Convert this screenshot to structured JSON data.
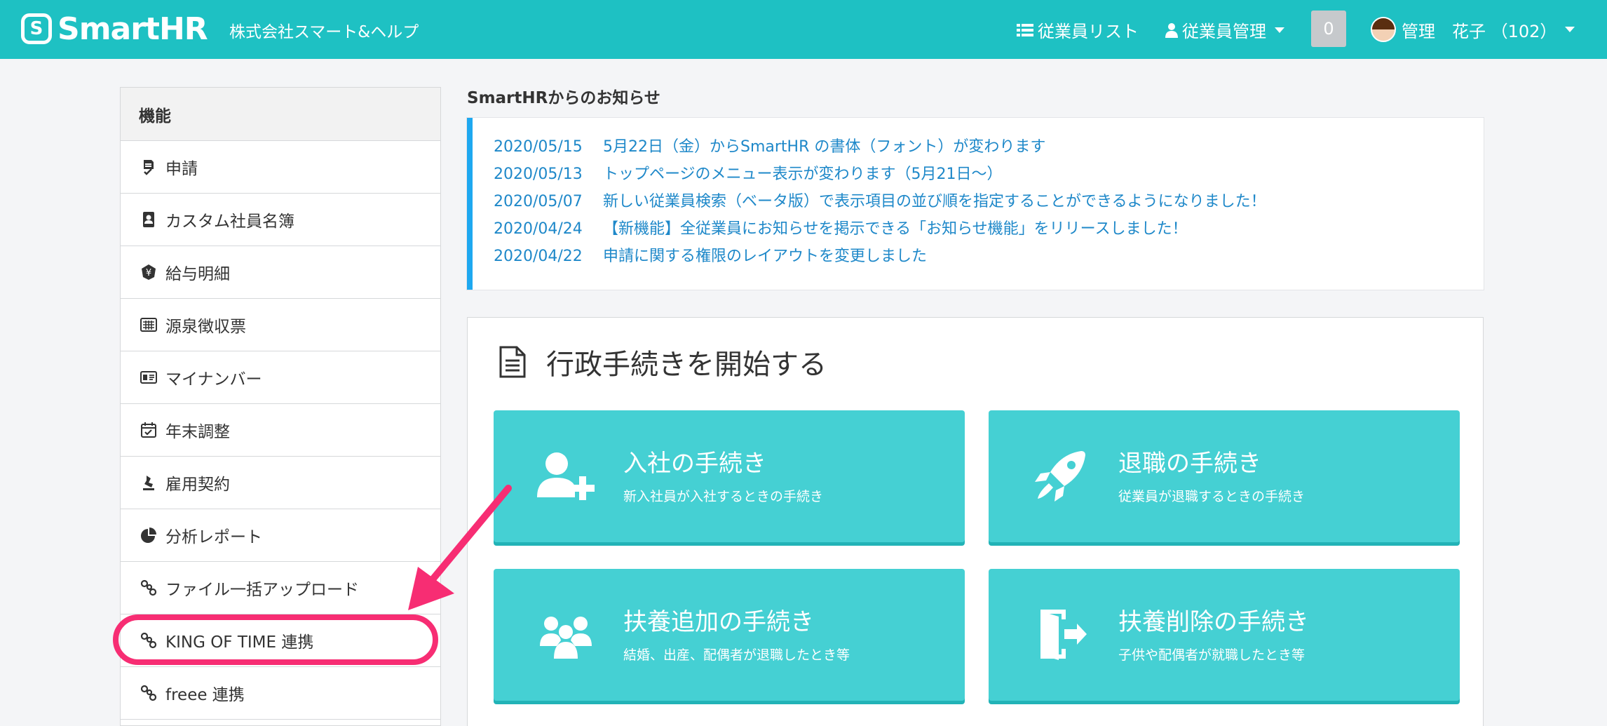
{
  "header": {
    "logo_mark": "S",
    "logo_text": "SmartHR",
    "company": "株式会社スマート&ヘルプ",
    "nav_employee_list": "従業員リスト",
    "nav_employee_manage": "従業員管理",
    "notification_count": "0",
    "user_name": "管理　花子 （102）",
    "brand_color": "#1ec1c3"
  },
  "sidebar": {
    "heading": "機能",
    "items": [
      {
        "label": "申請",
        "icon": "application-icon"
      },
      {
        "label": "カスタム社員名簿",
        "icon": "contact-book-icon"
      },
      {
        "label": "給与明細",
        "icon": "yen-badge-icon"
      },
      {
        "label": "源泉徴収票",
        "icon": "calculator-icon"
      },
      {
        "label": "マイナンバー",
        "icon": "id-card-icon"
      },
      {
        "label": "年末調整",
        "icon": "calendar-check-icon"
      },
      {
        "label": "雇用契約",
        "icon": "stamp-icon"
      },
      {
        "label": "分析レポート",
        "icon": "pie-chart-icon"
      },
      {
        "label": "ファイル一括アップロード",
        "icon": "link-icon"
      },
      {
        "label": "KING OF TIME 連携",
        "icon": "link-icon"
      },
      {
        "label": "freee 連携",
        "icon": "link-icon"
      }
    ]
  },
  "notices": {
    "title": "SmartHRからのお知らせ",
    "items": [
      {
        "date": "2020/05/15",
        "text": "5月22日（金）からSmartHR の書体（フォント）が変わります"
      },
      {
        "date": "2020/05/13",
        "text": "トップページのメニュー表示が変わります（5月21日〜）"
      },
      {
        "date": "2020/05/07",
        "text": "新しい従業員検索（ベータ版）で表示項目の並び順を指定することができるようになりました！"
      },
      {
        "date": "2020/04/24",
        "text": "【新機能】全従業員にお知らせを掲示できる「お知らせ機能」をリリースしました！"
      },
      {
        "date": "2020/04/22",
        "text": "申請に関する権限のレイアウトを変更しました"
      }
    ]
  },
  "procedures": {
    "title": "行政手続きを開始する",
    "cards": [
      {
        "title": "入社の手続き",
        "subtitle": "新入社員が入社するときの手続き",
        "icon": "user-plus-icon"
      },
      {
        "title": "退職の手続き",
        "subtitle": "従業員が退職するときの手続き",
        "icon": "rocket-icon"
      },
      {
        "title": "扶養追加の手続き",
        "subtitle": "結婚、出産、配偶者が退職したとき等",
        "icon": "family-icon"
      },
      {
        "title": "扶養削除の手続き",
        "subtitle": "子供や配偶者が就職したとき等",
        "icon": "door-exit-icon"
      }
    ]
  }
}
